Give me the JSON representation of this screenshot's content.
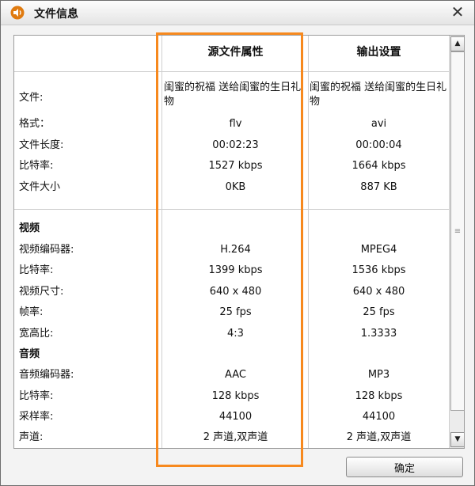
{
  "window": {
    "title": "文件信息",
    "app_icon": "speaker-icon",
    "close_glyph": "✕",
    "ok_label": "确定"
  },
  "table": {
    "col_source": "源文件属性",
    "col_output": "输出设置",
    "file": {
      "label": "文件:",
      "source": "闺蜜的祝福 送给闺蜜的生日礼物",
      "output": "闺蜜的祝福 送给闺蜜的生日礼物"
    },
    "general": [
      {
        "label": "格式：",
        "source": "flv",
        "output": "avi"
      },
      {
        "label": "文件长度:",
        "source": "00:02:23",
        "output": "00:00:04"
      },
      {
        "label": "比特率:",
        "source": "1527 kbps",
        "output": "1664 kbps"
      },
      {
        "label": "文件大小",
        "source": "0KB",
        "output": "887 KB"
      }
    ],
    "video_header": "视频",
    "video": [
      {
        "label": "视频编码器:",
        "source": "H.264",
        "output": "MPEG4"
      },
      {
        "label": "比特率:",
        "source": "1399 kbps",
        "output": "1536 kbps"
      },
      {
        "label": "视频尺寸:",
        "source": "640 x 480",
        "output": "640 x 480"
      },
      {
        "label": "帧率:",
        "source": "25 fps",
        "output": "25 fps"
      },
      {
        "label": "宽高比:",
        "source": "4:3",
        "output": "1.3333"
      }
    ],
    "audio_header": "音频",
    "audio": [
      {
        "label": "音频编码器:",
        "source": "AAC",
        "output": "MP3"
      },
      {
        "label": "比特率:",
        "source": "128 kbps",
        "output": "128 kbps"
      },
      {
        "label": "采样率:",
        "source": "44100",
        "output": "44100"
      },
      {
        "label": "声道:",
        "source": "2 声道,双声道",
        "output": "2 声道,双声道"
      }
    ]
  },
  "colors": {
    "highlight": "#f7891e",
    "icon_orange": "#e07b10"
  }
}
